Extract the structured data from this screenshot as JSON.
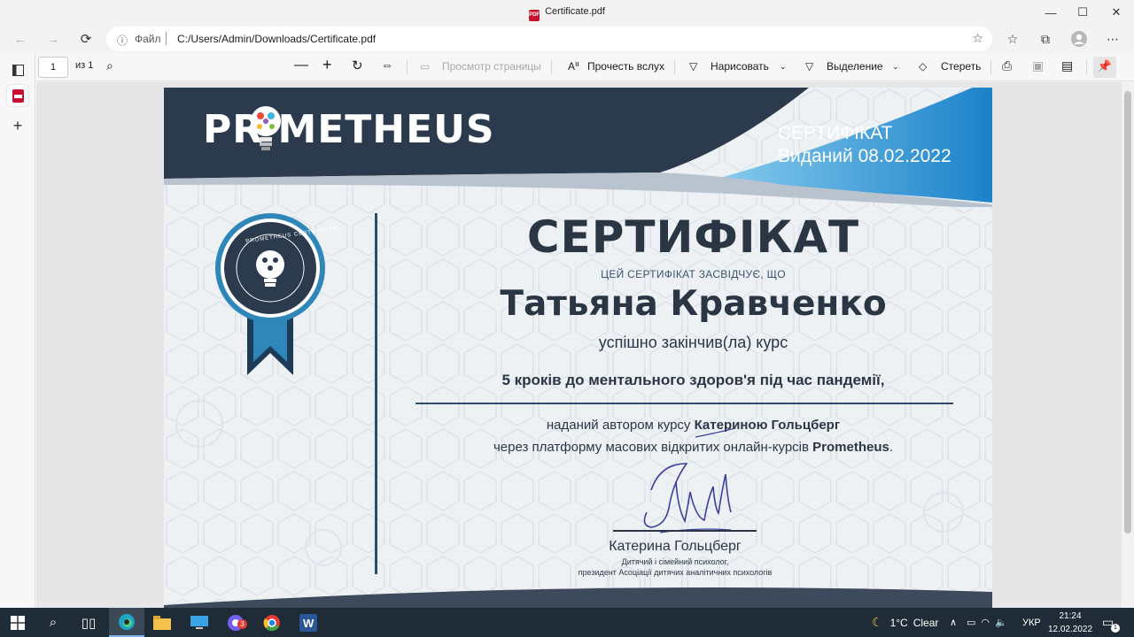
{
  "window": {
    "title": "Certificate.pdf",
    "minimize_icon": "—",
    "maximize_icon": "☐",
    "close_icon": "✕"
  },
  "address_bar": {
    "file_label": "Файл",
    "url": "C:/Users/Admin/Downloads/Certificate.pdf"
  },
  "pdf_toolbar": {
    "page_current": "1",
    "page_total": "из 1",
    "page_view": "Просмотр страницы",
    "read_aloud": "Прочесть вслух",
    "draw": "Нарисовать",
    "highlight": "Выделение",
    "erase": "Стереть"
  },
  "certificate": {
    "logo_text": "PR METHEUS",
    "header_title": "СЕРТИФІКАТ",
    "header_issued": "Виданий 08.02.2022",
    "title": "СЕРТИФІКАТ",
    "subtitle": "ЦЕЙ СЕРТИФІКАТ ЗАСВІДЧУЄ, ЩО",
    "recipient": "Татьяна Кравченко",
    "finished": "успішно закінчив(ла) курс",
    "course": "5 кроків до ментального здоров'я під час пандемії,",
    "line1_prefix": "наданий автором курсу ",
    "line1_author": "Катериною Гольцберг",
    "line2_prefix": "через платформу масових відкритих онлайн-курсів ",
    "line2_platform": "Prometheus",
    "line2_suffix": ".",
    "seal_text": "PROMETHEUS CERTIFICATE",
    "signer_name": "Катерина Гольцберг",
    "signer_role1": "Дитячий і сімейний психолог,",
    "signer_role2": "президент Асоціації дитячих аналітичних психологів",
    "colors": {
      "navy": "#2b3645",
      "accent_blue": "#1f8fd0",
      "seal_blue": "#2f86b8"
    }
  },
  "taskbar": {
    "weather_temp": "1°C",
    "weather_desc": "Clear",
    "language": "УКР",
    "time": "21:24",
    "date": "12.02.2022",
    "notification_count": "1",
    "viber_badge": "3"
  }
}
